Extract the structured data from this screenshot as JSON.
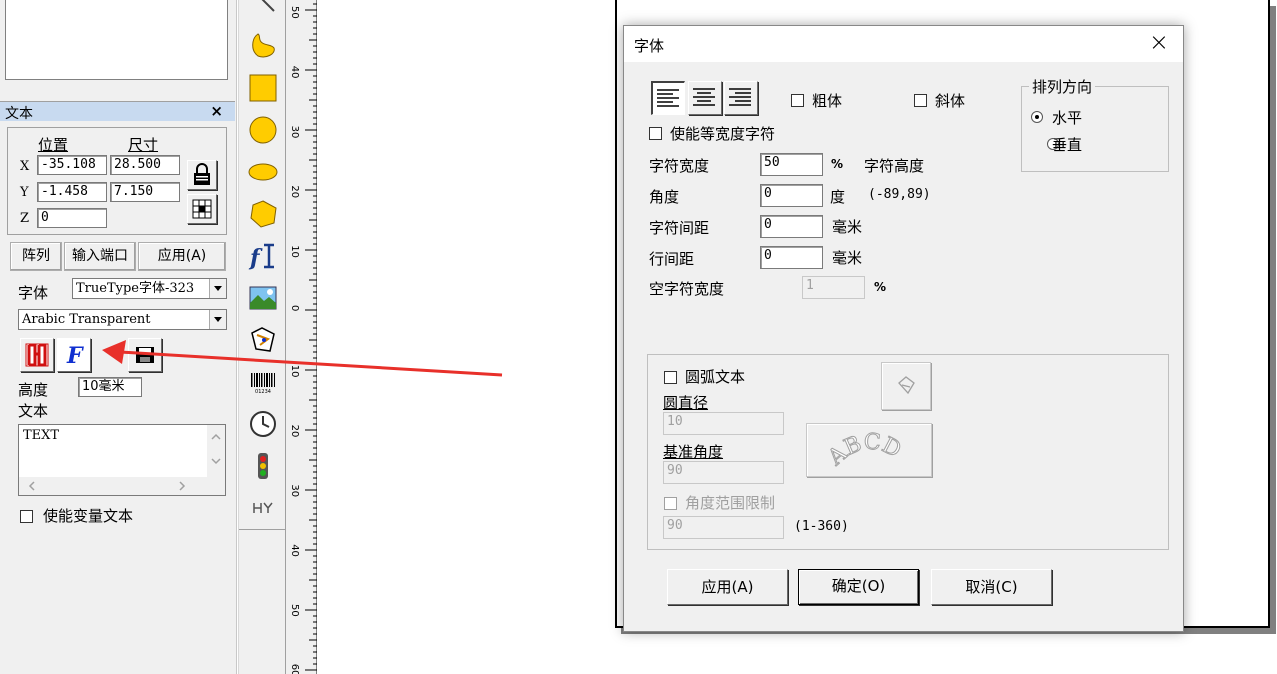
{
  "left_panel": {
    "panel_title": "文本",
    "close_symbol": "×",
    "position_header": "位置",
    "size_header": "尺寸",
    "x_label": "X",
    "y_label": "Y",
    "z_label": "Z",
    "x_position": "-35.108",
    "y_position": "-1.458",
    "z_position": "0",
    "x_size": "28.500",
    "y_size": "7.150",
    "array_button": "阵列",
    "input_port_button": "输入端口",
    "apply_button": "应用(A)",
    "font_label": "字体",
    "font_type_value": "TrueType字体-323",
    "font_name_value": "Arabic Transparent",
    "height_label": "高度",
    "height_value": "10毫米",
    "text_label": "文本",
    "text_value": "TEXT",
    "variable_text_label": "使能变量文本"
  },
  "ruler": {
    "labels": [
      "50",
      "40",
      "30",
      "20",
      "10",
      "0",
      "10",
      "20",
      "30",
      "40",
      "50",
      "60"
    ]
  },
  "toolbar": {
    "barcode_caption": "01234"
  },
  "dialog": {
    "title": "字体",
    "close_symbol": "×",
    "bold_label": "粗体",
    "italic_label": "斜体",
    "fixed_width_label": "使能等宽度字符",
    "char_width_label": "字符宽度",
    "char_width_value": "50",
    "char_width_unit": "%",
    "char_height_label": "字符高度",
    "angle_label": "角度",
    "angle_value": "0",
    "angle_unit": "度",
    "angle_range": "(-89,89)",
    "char_spacing_label": "字符间距",
    "char_spacing_value": "0",
    "char_spacing_unit": "毫米",
    "line_spacing_label": "行间距",
    "line_spacing_value": "0",
    "line_spacing_unit": "毫米",
    "space_width_label": "空字符宽度",
    "space_width_value": "1",
    "space_width_unit": "%",
    "direction_group_title": "排列方向",
    "horizontal_label": "水平",
    "vertical_label": "垂直",
    "arc_text_label": "圆弧文本",
    "diameter_label": "圆直径",
    "diameter_value": "10",
    "base_angle_label": "基准角度",
    "base_angle_value": "90",
    "arc_preview_text": "ABCD",
    "angle_limit_label": "角度范围限制",
    "angle_limit_value": "90",
    "angle_limit_range": "(1-360)",
    "apply_button": "应用(A)",
    "ok_button": "确定(O)",
    "cancel_button": "取消(C)"
  },
  "colors": {
    "shape_fill": "#ffcc00",
    "arrow": "#e8302a",
    "italic_f": "#1030d0",
    "bold_h": "#d01010"
  }
}
